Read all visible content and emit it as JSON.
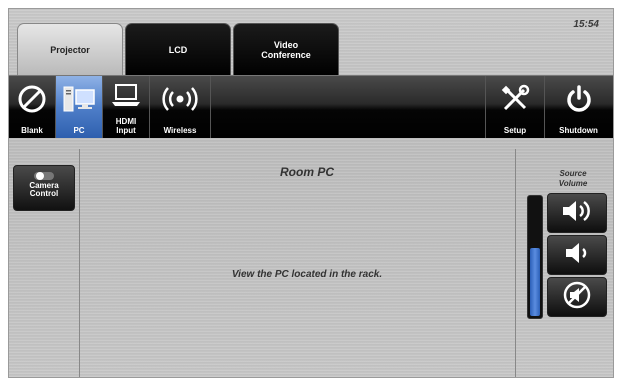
{
  "clock": "15:54",
  "tabs": [
    {
      "label": "Projector",
      "active": true
    },
    {
      "label": "LCD",
      "active": false
    },
    {
      "label": "Video\nConference",
      "active": false
    }
  ],
  "toolbar": {
    "blank": {
      "label": "Blank",
      "icon": "blank-icon"
    },
    "pc": {
      "label": "PC",
      "icon": "pc-icon",
      "selected": true
    },
    "hdmi": {
      "label": "HDMI\nInput",
      "icon": "laptop-icon"
    },
    "wireless": {
      "label": "Wireless",
      "icon": "wireless-icon"
    },
    "setup": {
      "label": "Setup",
      "icon": "tools-icon"
    },
    "shutdown": {
      "label": "Shutdown",
      "icon": "power-icon"
    }
  },
  "camera_control": {
    "label": "Camera\nControl",
    "icon": "toggle-icon"
  },
  "main": {
    "title": "Room PC",
    "message": "View the PC located in the rack."
  },
  "volume": {
    "label": "Source\nVolume",
    "level": 0.58,
    "up_icon": "volume-up-icon",
    "down_icon": "volume-down-icon",
    "mute_icon": "mute-icon"
  },
  "colors": {
    "toolbar_selected": "#4f7fc9",
    "volume_fill": "#3a6fcc",
    "toolbar_bg": "#000000"
  }
}
